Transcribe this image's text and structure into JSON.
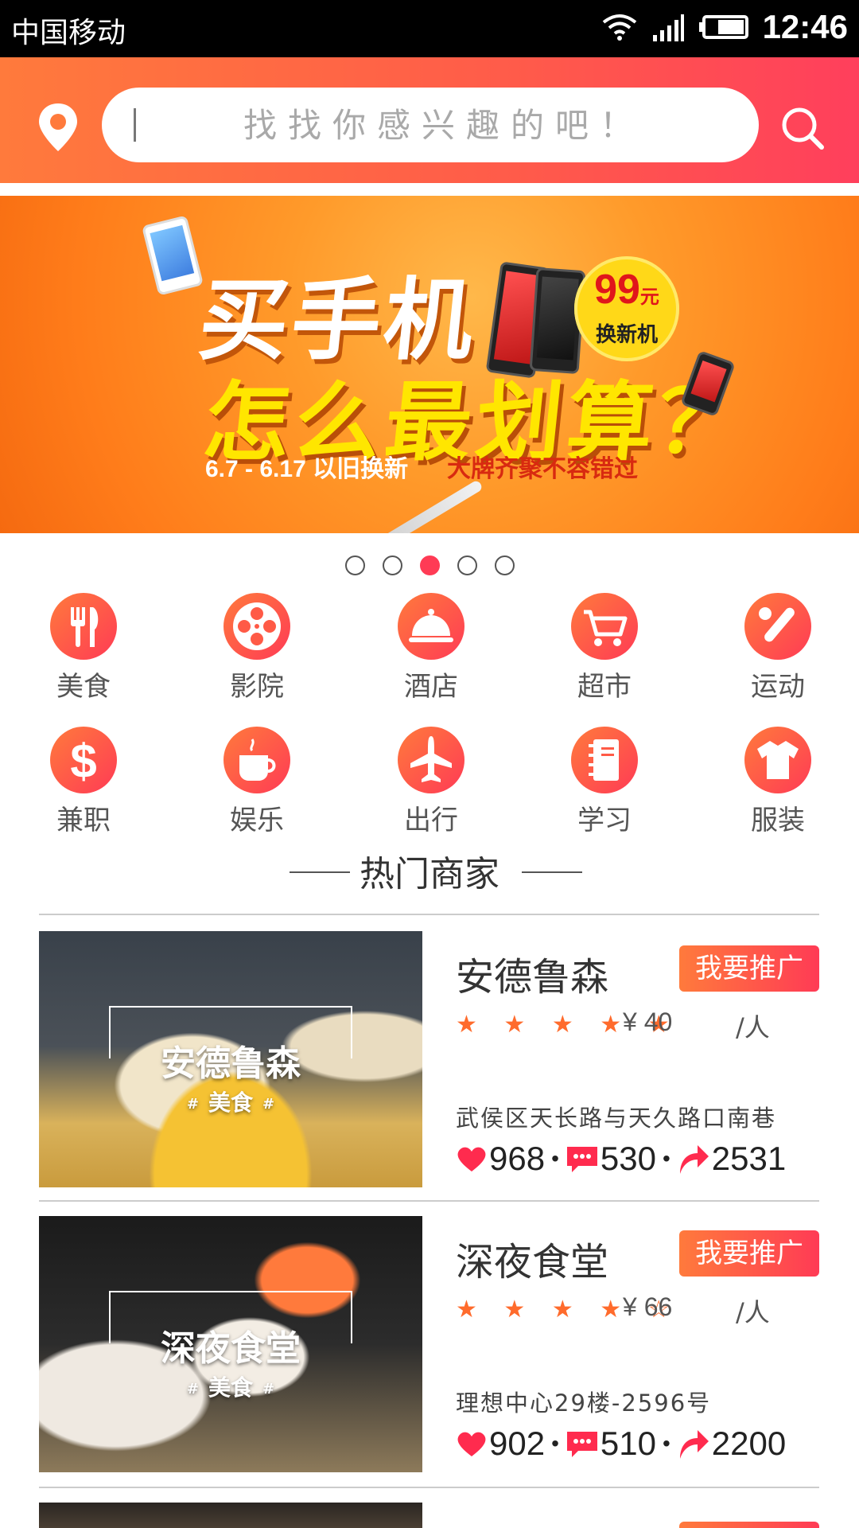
{
  "status_bar": {
    "carrier": "中国移动",
    "time": "12:46"
  },
  "header": {
    "search_placeholder": "找找你感兴趣的吧！",
    "icons": [
      "location-pin-icon",
      "search-icon"
    ]
  },
  "banner": {
    "line1": "买手机",
    "line2": "怎么最划算？",
    "sub_left": "6.7 - 6.17 以旧换新",
    "sub_right": "大牌齐聚不容错过",
    "badge_price": "99",
    "badge_unit": "元",
    "badge_text": "换新机"
  },
  "carousel": {
    "count": 5,
    "active_index": 2
  },
  "categories": [
    {
      "label": "美食",
      "icon": "fork-knife-icon"
    },
    {
      "label": "影院",
      "icon": "film-reel-icon"
    },
    {
      "label": "酒店",
      "icon": "service-bell-icon"
    },
    {
      "label": "超市",
      "icon": "shopping-cart-icon"
    },
    {
      "label": "运动",
      "icon": "baseball-icon"
    },
    {
      "label": "兼职",
      "icon": "dollar-icon"
    },
    {
      "label": "娱乐",
      "icon": "coffee-cup-icon"
    },
    {
      "label": "出行",
      "icon": "airplane-icon"
    },
    {
      "label": "学习",
      "icon": "notebook-icon"
    },
    {
      "label": "服装",
      "icon": "tshirt-icon"
    }
  ],
  "section_title": "热门商家",
  "merchants": [
    {
      "name": "安德鲁森",
      "thumb_tag": "美食",
      "promo_label": "我要推广",
      "rating": 5,
      "stars_text": "★ ★ ★ ★ ★",
      "price": "¥ 40",
      "price_unit": "/人",
      "address": "武侯区天长路与天久路口南巷",
      "likes": "968",
      "comments": "530",
      "shares": "2531"
    },
    {
      "name": "深夜食堂",
      "thumb_tag": "美食",
      "promo_label": "我要推广",
      "rating": 4,
      "stars_text": "★ ★ ★ ★ ☆",
      "price": "¥ 66",
      "price_unit": "/人",
      "address": "理想中心29楼-2596号",
      "likes": "902",
      "comments": "510",
      "shares": "2200"
    }
  ],
  "colors": {
    "accent": "#ff3b55",
    "accent_orange": "#ff7a3c",
    "star": "#ff6b2c"
  }
}
